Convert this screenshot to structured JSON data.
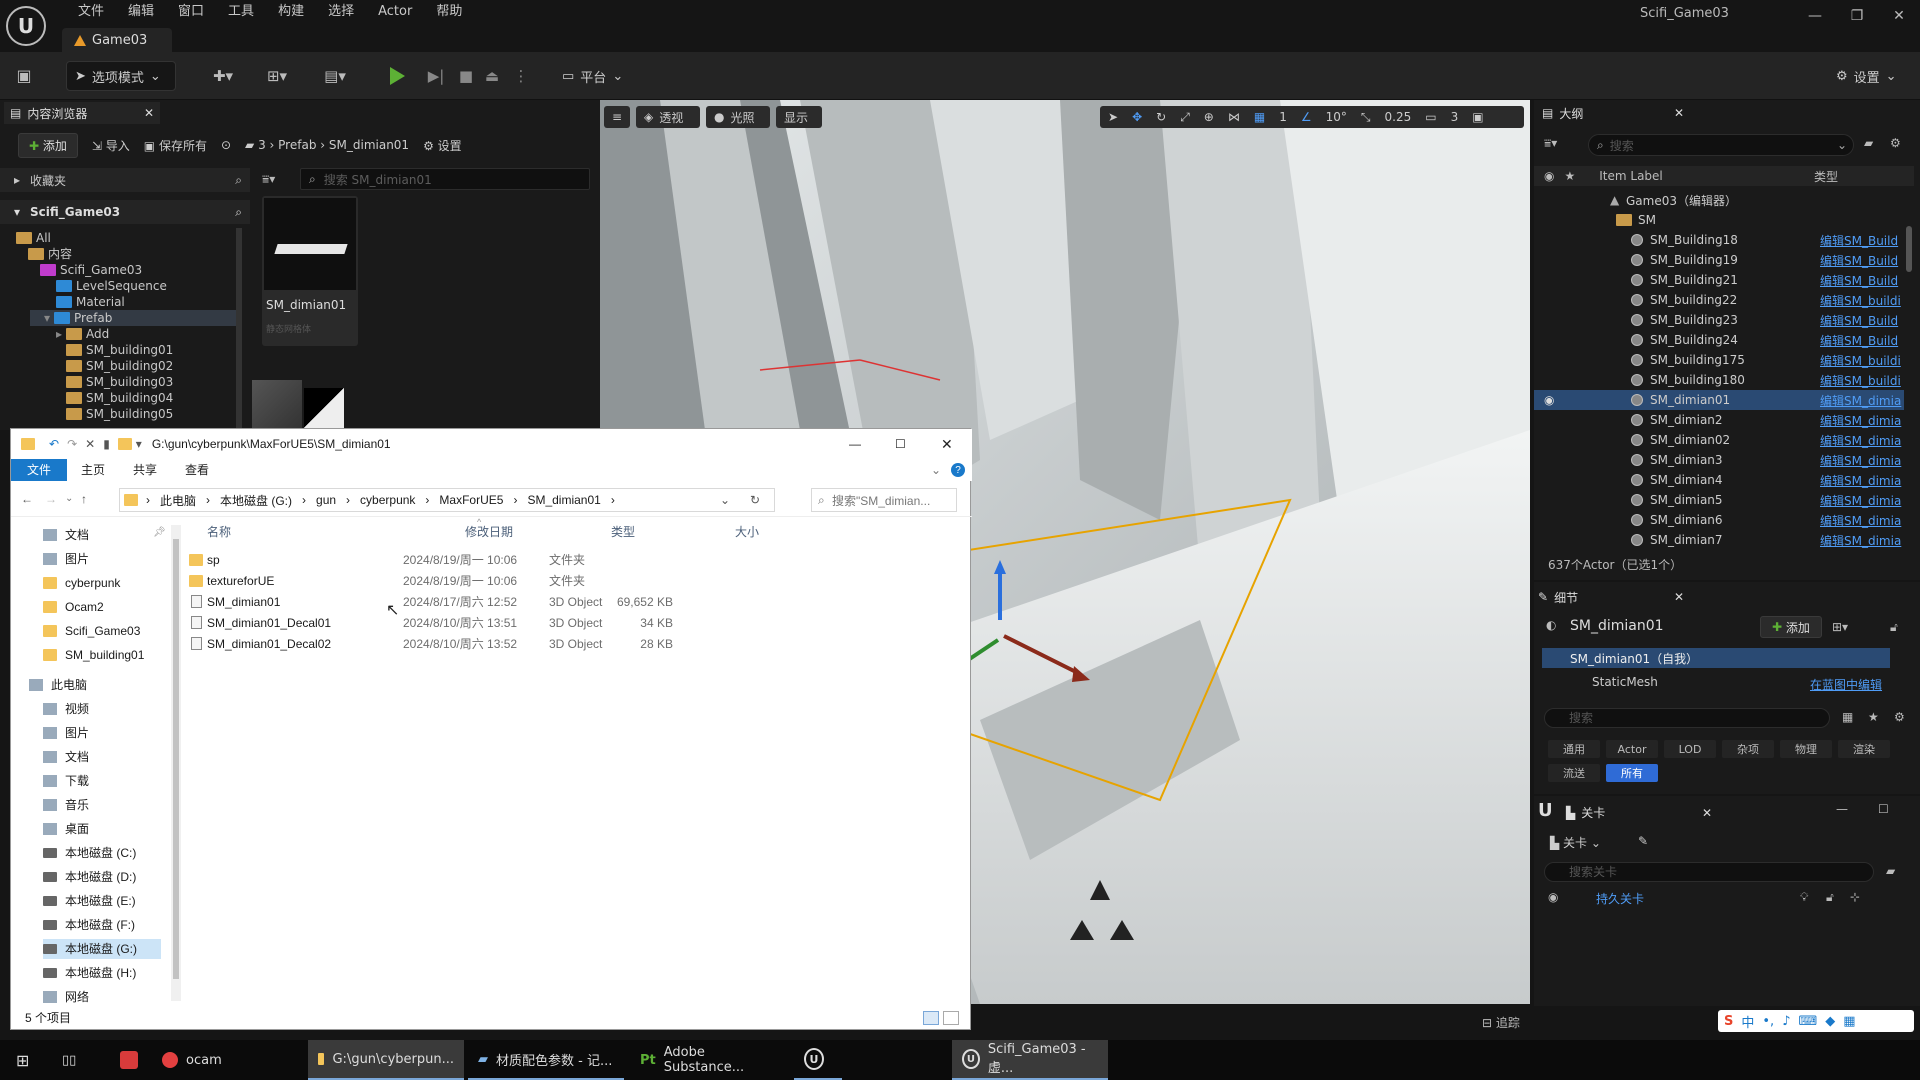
{
  "menu": [
    "文件",
    "编辑",
    "窗口",
    "工具",
    "构建",
    "选择",
    "Actor",
    "帮助"
  ],
  "level_tab": "Game03",
  "project_title": "Scifi_Game03",
  "toolbar": {
    "mode_label": "选项模式",
    "platform_label": "平台",
    "settings_label": "设置"
  },
  "content_browser": {
    "tab_title": "内容浏览器",
    "add_label": "添加",
    "import_label": "导入",
    "save_all_label": "保存所有",
    "breadcrumb": [
      "3",
      "Prefab",
      "SM_dimian01"
    ],
    "settings_label": "设置",
    "favorites_label": "收藏夹",
    "project_label": "Scifi_Game03",
    "search_placeholder": "搜索 SM_dimian01",
    "tree": [
      "All",
      "内容",
      "Scifi_Game03",
      "LevelSequence",
      "Material",
      "Prefab",
      "Add",
      "SM_building01",
      "SM_building02",
      "SM_building03",
      "SM_building04",
      "SM_building05"
    ],
    "asset_name": "SM_dimian01",
    "asset_type": "静态网格体"
  },
  "viewport": {
    "perspective_label": "透视",
    "lit_label": "光照",
    "show_label": "显示",
    "grid_value": "1",
    "angle_value": "10°",
    "scale_value": "0.25",
    "camera_value": "3",
    "track_label": "追踪"
  },
  "outliner": {
    "tab_title": "大纲",
    "search_placeholder": "搜索",
    "col_label": "Item Label",
    "col_type": "类型",
    "root": "Game03（编辑器）",
    "folder": "SM",
    "rows": [
      {
        "name": "SM_Building18",
        "type": "编辑SM_Build"
      },
      {
        "name": "SM_Building19",
        "type": "编辑SM_Build"
      },
      {
        "name": "SM_Building21",
        "type": "编辑SM_Build"
      },
      {
        "name": "SM_building22",
        "type": "编辑SM_buildi"
      },
      {
        "name": "SM_Building23",
        "type": "编辑SM_Build"
      },
      {
        "name": "SM_Building24",
        "type": "编辑SM_Build"
      },
      {
        "name": "SM_building175",
        "type": "编辑SM_buildi"
      },
      {
        "name": "SM_building180",
        "type": "编辑SM_buildi"
      },
      {
        "name": "SM_dimian01",
        "type": "编辑SM_dimia"
      },
      {
        "name": "SM_dimian2",
        "type": "编辑SM_dimia"
      },
      {
        "name": "SM_dimian02",
        "type": "编辑SM_dimia"
      },
      {
        "name": "SM_dimian3",
        "type": "编辑SM_dimia"
      },
      {
        "name": "SM_dimian4",
        "type": "编辑SM_dimia"
      },
      {
        "name": "SM_dimian5",
        "type": "编辑SM_dimia"
      },
      {
        "name": "SM_dimian6",
        "type": "编辑SM_dimia"
      },
      {
        "name": "SM_dimian7",
        "type": "编辑SM_dimia"
      }
    ],
    "count": "637个Actor（已选1个）"
  },
  "details": {
    "tab_title": "细节",
    "name": "SM_dimian01",
    "add_label": "添加",
    "self_label": "SM_dimian01（自我）",
    "mesh_label": "StaticMesh",
    "mesh_link": "在蓝图中编辑",
    "search_placeholder": "搜索",
    "tabs": [
      "通用",
      "Actor",
      "LOD",
      "杂项",
      "物理",
      "渲染",
      "流送",
      "所有"
    ]
  },
  "levels": {
    "tab_title": "关卡",
    "dropdown": "关卡",
    "search_placeholder": "搜索关卡",
    "item": "持久关卡"
  },
  "explorer": {
    "title": "G:\\gun\\cyberpunk\\MaxForUE5\\SM_dimian01",
    "ribbon": [
      "文件",
      "主页",
      "共享",
      "查看"
    ],
    "path": [
      "此电脑",
      "本地磁盘 (G:)",
      "gun",
      "cyberpunk",
      "MaxForUE5",
      "SM_dimian01"
    ],
    "search_placeholder": "搜索\"SM_dimian...",
    "nav_quick": [
      "文档",
      "图片",
      "cyberpunk",
      "Ocam2",
      "Scifi_Game03",
      "SM_building01"
    ],
    "nav_pc_label": "此电脑",
    "nav_pc": [
      "视频",
      "图片",
      "文档",
      "下载",
      "音乐",
      "桌面",
      "本地磁盘 (C:)",
      "本地磁盘 (D:)",
      "本地磁盘 (E:)",
      "本地磁盘 (F:)",
      "本地磁盘 (G:)",
      "本地磁盘 (H:)"
    ],
    "nav_net": "网络",
    "headers": [
      "名称",
      "修改日期",
      "类型",
      "大小"
    ],
    "files": [
      {
        "name": "sp",
        "date": "2024/8/19/周一 10:06",
        "type": "文件夹",
        "size": ""
      },
      {
        "name": "textureforUE",
        "date": "2024/8/19/周一 10:06",
        "type": "文件夹",
        "size": ""
      },
      {
        "name": "SM_dimian01",
        "date": "2024/8/17/周六 12:52",
        "type": "3D Object",
        "size": "69,652 KB"
      },
      {
        "name": "SM_dimian01_Decal01",
        "date": "2024/8/10/周六 13:51",
        "type": "3D Object",
        "size": "34 KB"
      },
      {
        "name": "SM_dimian01_Decal02",
        "date": "2024/8/10/周六 13:52",
        "type": "3D Object",
        "size": "28 KB"
      }
    ],
    "status": "5 个项目"
  },
  "taskbar": [
    {
      "label": "ocam"
    },
    {
      "label": "G:\\gun\\cyberpun..."
    },
    {
      "label": "材质配色参数 - 记..."
    },
    {
      "label": "Adobe Substance..."
    },
    {
      "label": ""
    },
    {
      "label": "Scifi_Game03 - 虚..."
    }
  ],
  "ime": "中"
}
